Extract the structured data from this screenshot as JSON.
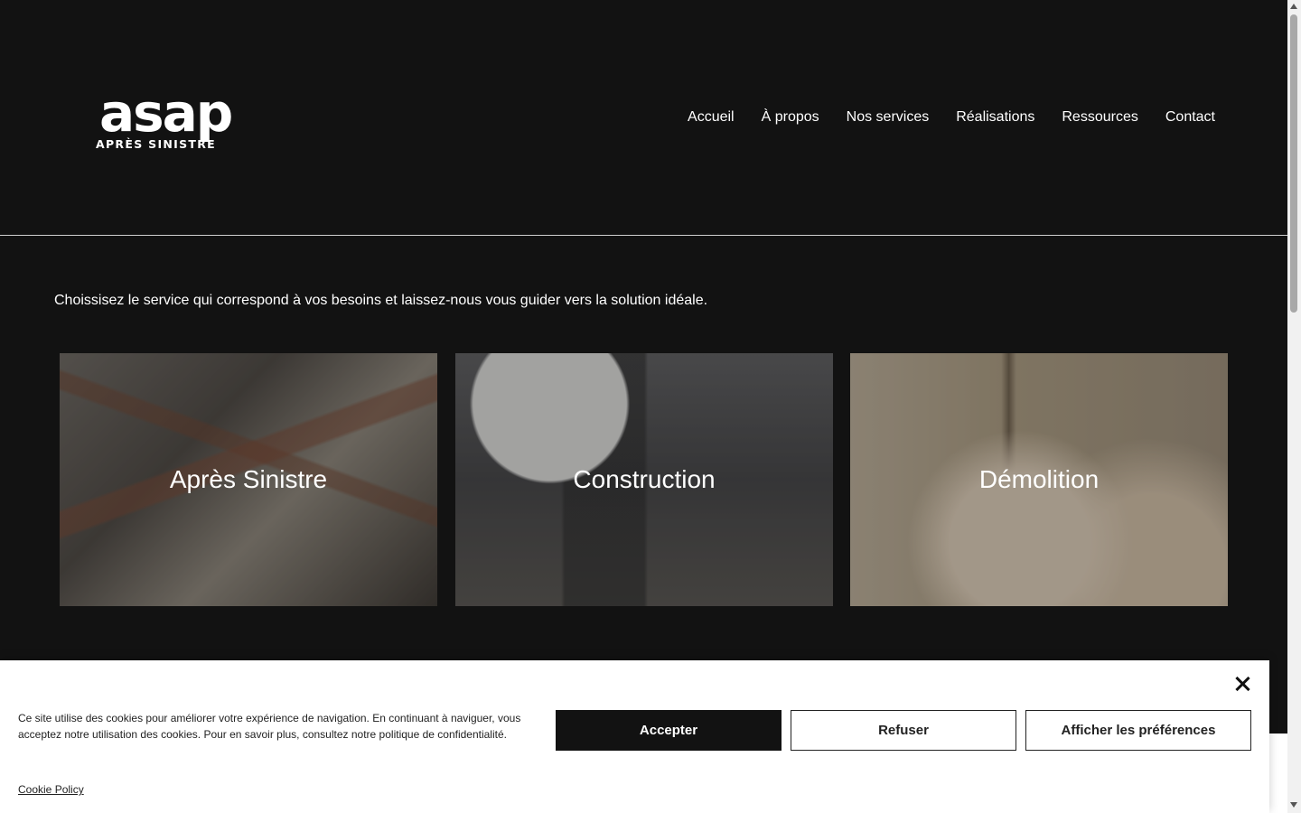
{
  "logo": {
    "word": "asap",
    "subtitle": "APRÈS SINISTRE"
  },
  "nav": {
    "items": [
      "Accueil",
      "À propos",
      "Nos services",
      "Réalisations",
      "Ressources",
      "Contact"
    ]
  },
  "intro": "Choissisez le service qui correspond à vos besoins et laissez-nous vous guider vers la solution idéale.",
  "services": [
    {
      "title": "Après Sinistre"
    },
    {
      "title": "Construction"
    },
    {
      "title": "Démolition"
    }
  ],
  "cookie": {
    "message": "Ce site utilise des cookies pour améliorer votre expérience de navigation. En continuant à naviguer, vous acceptez notre utilisation des cookies. Pour en savoir plus, consultez notre politique de confidentialité.",
    "accept_label": "Accepter",
    "refuse_label": "Refuser",
    "preferences_label": "Afficher les préférences",
    "policy_link": "Cookie Policy"
  },
  "colors": {
    "background": "#121212",
    "text": "#ffffff",
    "button_primary": "#121212"
  }
}
